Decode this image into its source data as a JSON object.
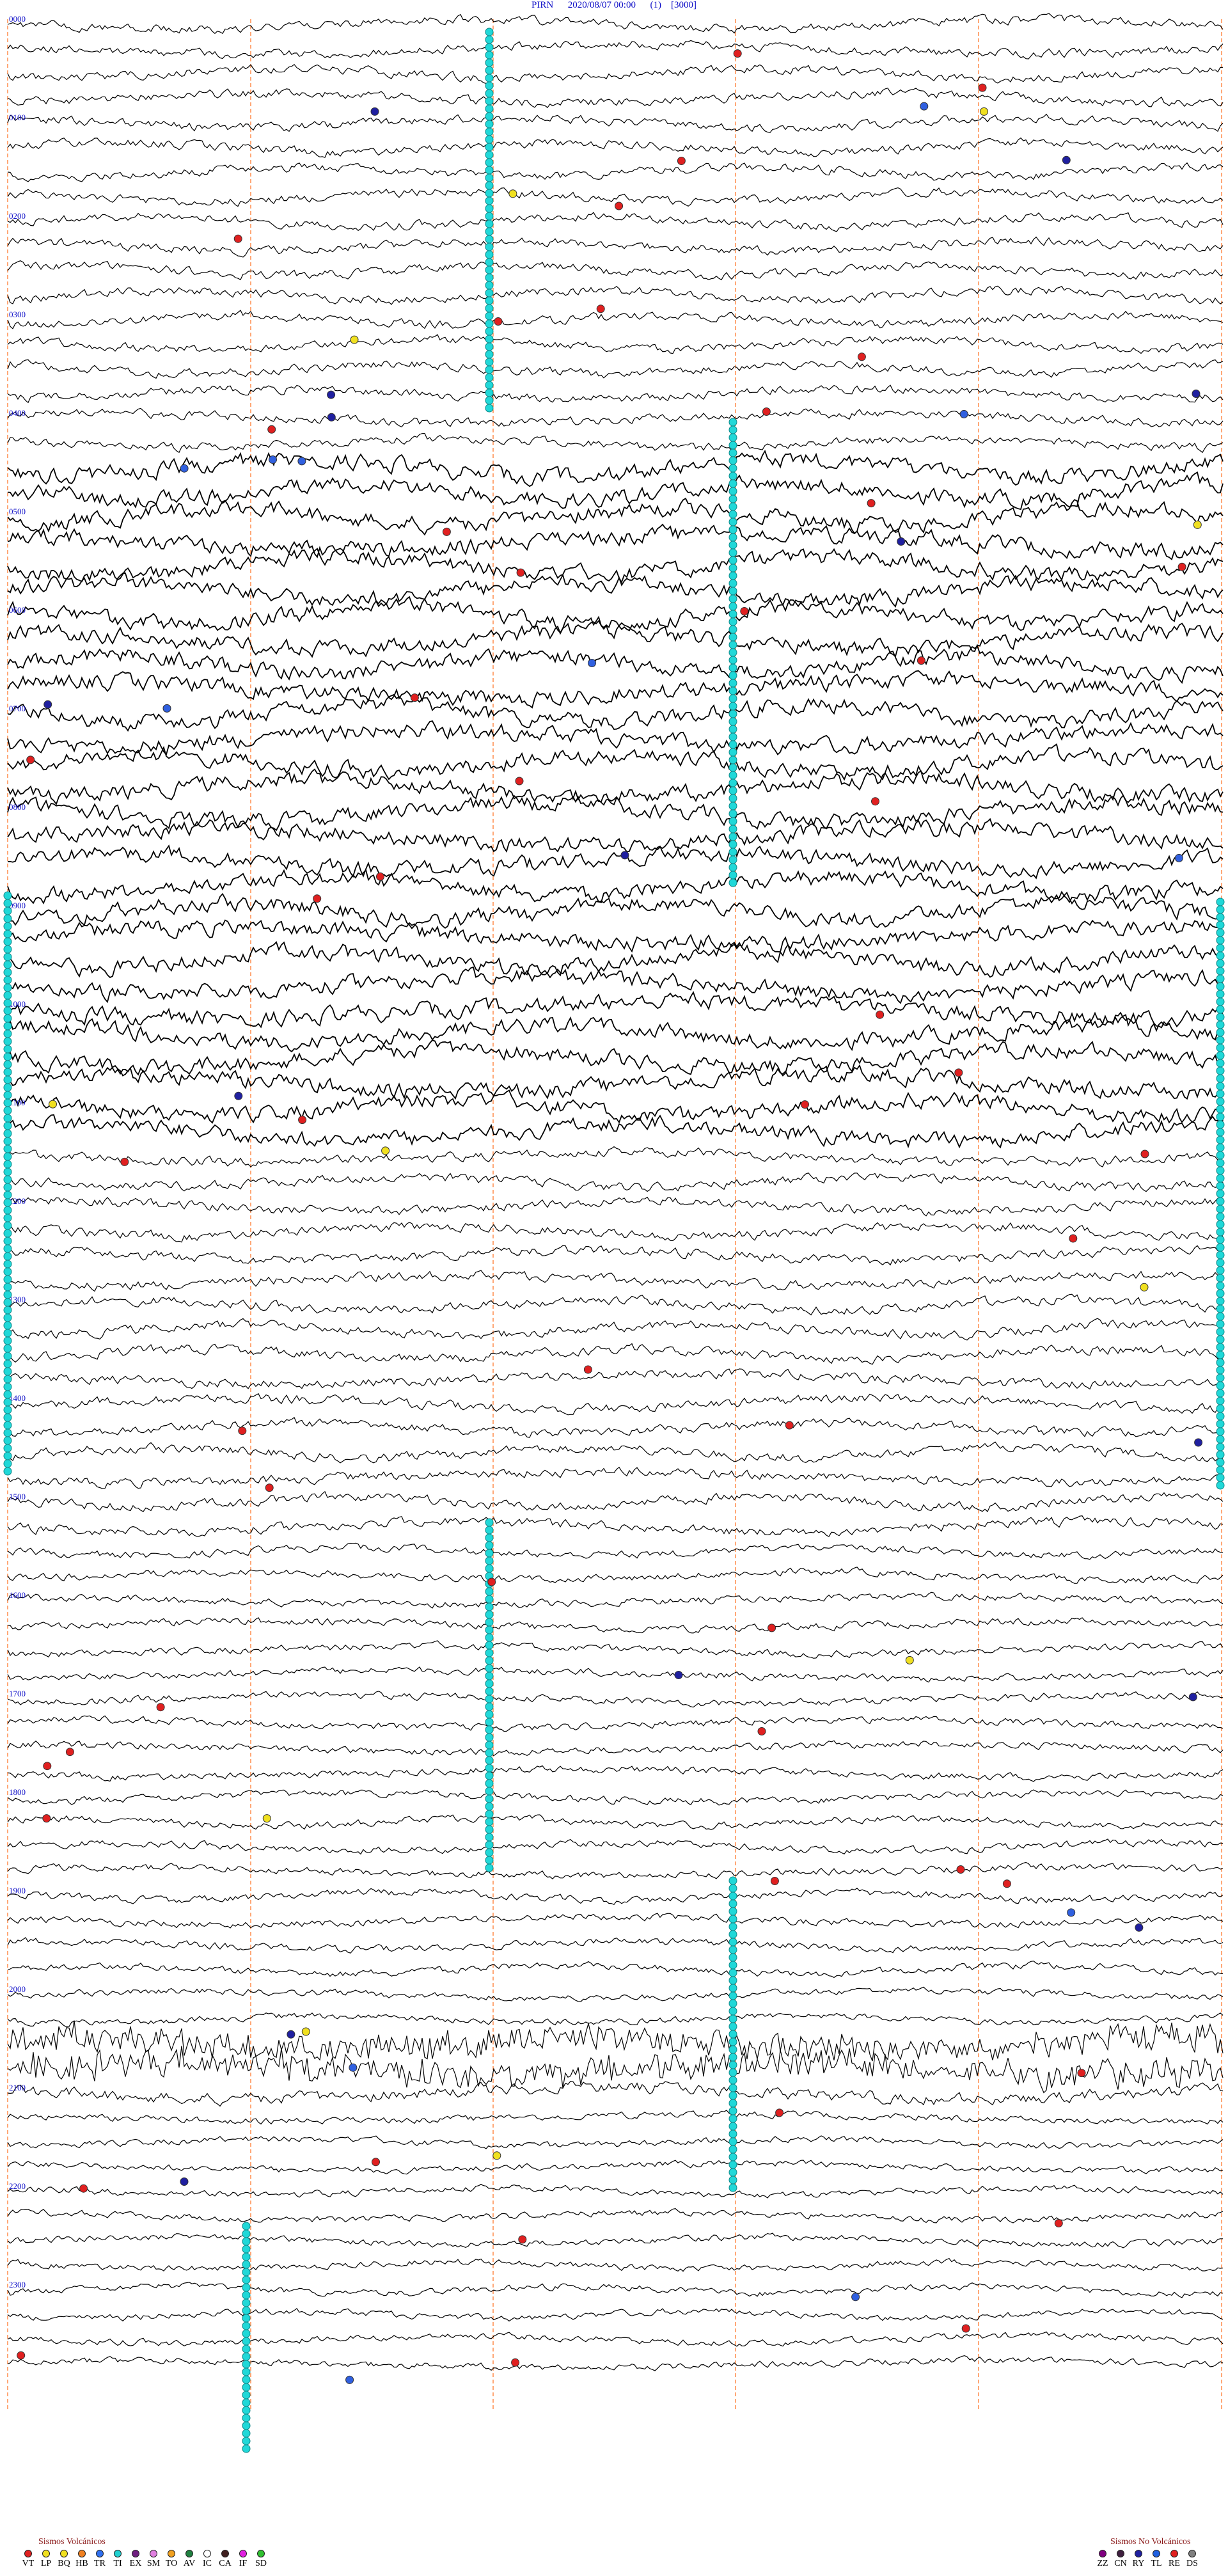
{
  "header": {
    "station": "PIRN",
    "datetime": "2020/08/07 00:00",
    "index": "(1)",
    "scale": "[3000]"
  },
  "chart_data": {
    "type": "line",
    "title": "PIRN     2020/08/07 00:00     (1)    [3000]",
    "rows": 96,
    "minutes_per_row": 15,
    "row_labels": [
      "0000",
      "0100",
      "0200",
      "0300",
      "0400",
      "0500",
      "0600",
      "0700",
      "0800",
      "0900",
      "1000",
      "1100",
      "1200",
      "1300",
      "1400",
      "1500",
      "1600",
      "1700",
      "1800",
      "1900",
      "2000",
      "2100",
      "2200",
      "2300"
    ],
    "grid": true,
    "event_marks_note": "colored circles mark classified seismic events along the helicorder traces"
  },
  "legend_volcanic": {
    "title": "Sismos Volcánicos",
    "items": [
      {
        "code": "VT",
        "color": "#e02020"
      },
      {
        "code": "LP",
        "color": "#f0e020"
      },
      {
        "code": "BQ",
        "color": "#f0e020"
      },
      {
        "code": "HB",
        "color": "#f08020"
      },
      {
        "code": "TR",
        "color": "#3070f0"
      },
      {
        "code": "TI",
        "color": "#20d0d0"
      },
      {
        "code": "EX",
        "color": "#702080"
      },
      {
        "code": "SM",
        "color": "#e080e0"
      },
      {
        "code": "TO",
        "color": "#f0a020"
      },
      {
        "code": "AV",
        "color": "#208040"
      },
      {
        "code": "IC",
        "color": "#ffffff"
      },
      {
        "code": "CA",
        "color": "#402020"
      },
      {
        "code": "IF",
        "color": "#e020e0"
      },
      {
        "code": "SD",
        "color": "#30c030"
      }
    ]
  },
  "legend_nonvolcanic": {
    "title": "Sismos No Volcánicos",
    "items": [
      {
        "code": "ZZ",
        "color": "#800080"
      },
      {
        "code": "CN",
        "color": "#402040"
      },
      {
        "code": "RY",
        "color": "#2020a0"
      },
      {
        "code": "TL",
        "color": "#2060e0"
      },
      {
        "code": "RE",
        "color": "#e02020"
      },
      {
        "code": "DS",
        "color": "#808080"
      }
    ]
  }
}
